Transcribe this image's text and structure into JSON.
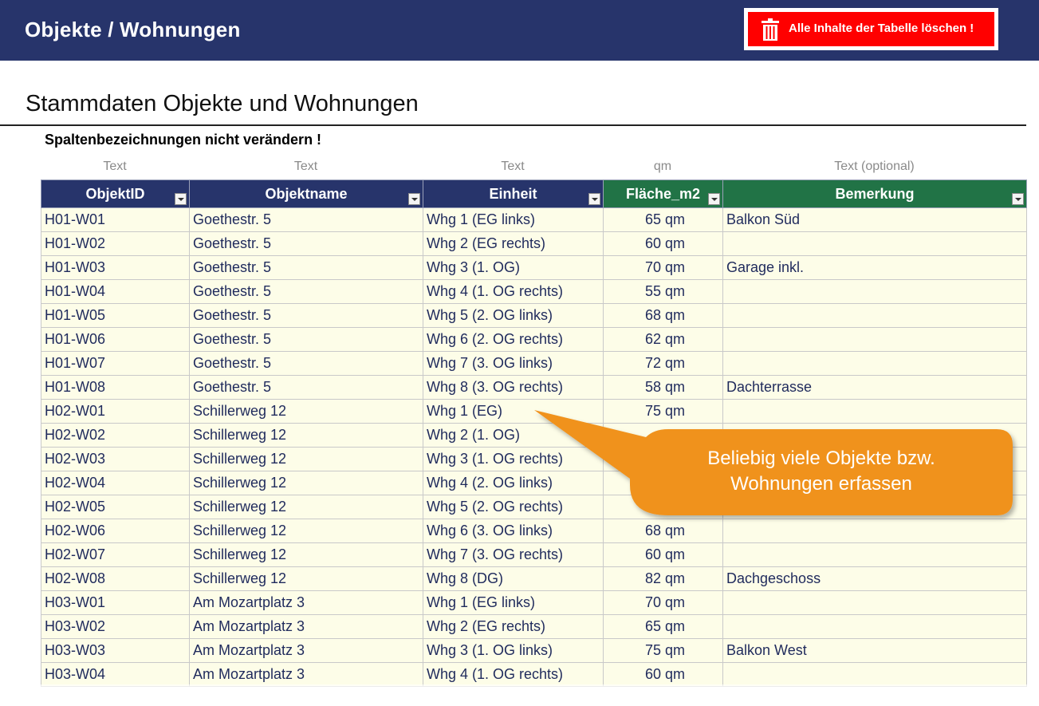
{
  "header": {
    "title": "Objekte / Wohnungen",
    "clear_button_label": "Alle Inhalte der Tabelle löschen !"
  },
  "section": {
    "title": "Stammdaten Objekte und Wohnungen",
    "warning": "Spaltenbezeichnungen nicht verändern !"
  },
  "column_types": [
    "Text",
    "Text",
    "Text",
    "qm",
    "Text (optional)"
  ],
  "columns": [
    "ObjektID",
    "Objektname",
    "Einheit",
    "Fläche_m2",
    "Bemerkung"
  ],
  "rows": [
    [
      "H01-W01",
      "Goethestr. 5",
      "Whg 1 (EG links)",
      "65 qm",
      "Balkon Süd"
    ],
    [
      "H01-W02",
      "Goethestr. 5",
      "Whg 2 (EG rechts)",
      "60 qm",
      ""
    ],
    [
      "H01-W03",
      "Goethestr. 5",
      "Whg 3 (1. OG)",
      "70 qm",
      "Garage inkl."
    ],
    [
      "H01-W04",
      "Goethestr. 5",
      "Whg 4 (1. OG rechts)",
      "55 qm",
      ""
    ],
    [
      "H01-W05",
      "Goethestr. 5",
      "Whg 5 (2. OG links)",
      "68 qm",
      ""
    ],
    [
      "H01-W06",
      "Goethestr. 5",
      "Whg 6 (2. OG rechts)",
      "62 qm",
      ""
    ],
    [
      "H01-W07",
      "Goethestr. 5",
      "Whg 7 (3. OG links)",
      "72 qm",
      ""
    ],
    [
      "H01-W08",
      "Goethestr. 5",
      "Whg 8 (3. OG rechts)",
      "58 qm",
      "Dachterrasse"
    ],
    [
      "H02-W01",
      "Schillerweg 12",
      "Whg 1 (EG)",
      "75 qm",
      ""
    ],
    [
      "H02-W02",
      "Schillerweg 12",
      "Whg 2 (1. OG)",
      "",
      ""
    ],
    [
      "H02-W03",
      "Schillerweg 12",
      "Whg 3 (1. OG rechts)",
      "",
      ""
    ],
    [
      "H02-W04",
      "Schillerweg 12",
      "Whg 4 (2. OG links)",
      "",
      ""
    ],
    [
      "H02-W05",
      "Schillerweg 12",
      "Whg 5 (2. OG rechts)",
      "",
      ""
    ],
    [
      "H02-W06",
      "Schillerweg 12",
      "Whg 6 (3. OG links)",
      "68 qm",
      ""
    ],
    [
      "H02-W07",
      "Schillerweg 12",
      "Whg 7 (3. OG rechts)",
      "60 qm",
      ""
    ],
    [
      "H02-W08",
      "Schillerweg 12",
      "Whg 8 (DG)",
      "82 qm",
      "Dachgeschoss"
    ],
    [
      "H03-W01",
      "Am Mozartplatz 3",
      "Whg 1 (EG links)",
      "70 qm",
      ""
    ],
    [
      "H03-W02",
      "Am Mozartplatz 3",
      "Whg 2 (EG rechts)",
      "65 qm",
      ""
    ],
    [
      "H03-W03",
      "Am Mozartplatz 3",
      "Whg 3 (1. OG links)",
      "75 qm",
      "Balkon West"
    ],
    [
      "H03-W04",
      "Am Mozartplatz 3",
      "Whg 4 (1. OG rechts)",
      "60 qm",
      ""
    ]
  ],
  "callout": {
    "text": "Beliebig viele Objekte bzw. Wohnungen erfassen"
  },
  "colors": {
    "header_bg": "#27346b",
    "header_green": "#217346",
    "delete_button": "#ff0000",
    "cell_bg": "#fdfde8",
    "callout": "#f0921e"
  }
}
